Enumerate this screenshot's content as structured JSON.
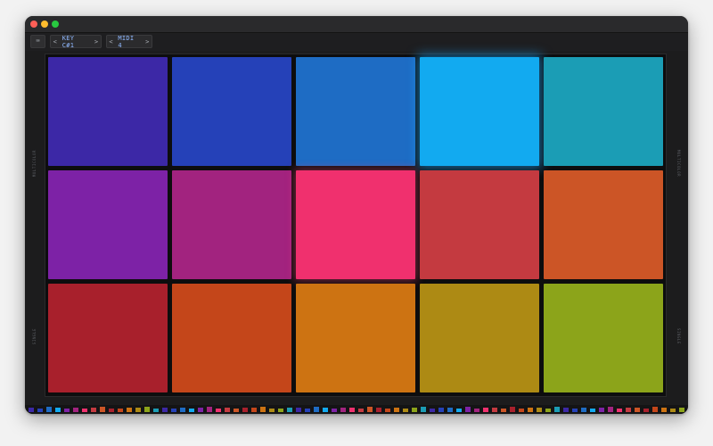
{
  "window": {
    "controls": [
      "close",
      "minimize",
      "zoom"
    ]
  },
  "toolbar": {
    "mode_icon": "keyboard-icon",
    "mode_glyph": "⌨",
    "key_selector": {
      "prev": "<",
      "value": "KEY C#1",
      "next": ">"
    },
    "midi_selector": {
      "prev": "<",
      "value": "MIDI 4",
      "next": ">"
    }
  },
  "side_labels": {
    "left_top": "MULTICOLOR",
    "left_bottom": "SINGLE",
    "right_top": "MULTICOLOR",
    "right_bottom": "SINGLE"
  },
  "pads": {
    "rows": [
      [
        {
          "color": "#3c28a6"
        },
        {
          "color": "#2541b8"
        },
        {
          "color": "#1e6cc4"
        },
        {
          "color": "#12aaf0",
          "active": true
        },
        {
          "color": "#1b9db5"
        }
      ],
      [
        {
          "color": "#7d22a6"
        },
        {
          "color": "#a2237f"
        },
        {
          "color": "#f0306e",
          "active": true
        },
        {
          "color": "#c43a40"
        },
        {
          "color": "#cc5526"
        }
      ],
      [
        {
          "color": "#a8202c"
        },
        {
          "color": "#c4461a"
        },
        {
          "color": "#cd7312"
        },
        {
          "color": "#ad8a14"
        },
        {
          "color": "#8ca41a"
        }
      ]
    ]
  },
  "level_meter": {
    "colors": [
      "#3c28a6",
      "#2541b8",
      "#1e6cc4",
      "#12aaf0",
      "#7d22a6",
      "#a2237f",
      "#f0306e",
      "#c43a40",
      "#cc5526",
      "#a8202c",
      "#c4461a",
      "#cd7312",
      "#ad8a14",
      "#8ca41a",
      "#1b9db5"
    ],
    "levels": [
      0.5,
      0.4,
      0.7,
      0.5,
      0.3,
      0.6,
      0.4,
      0.5,
      0.8,
      0.4,
      0.3,
      0.6,
      0.5,
      0.7,
      0.4,
      0.5,
      0.3,
      0.6,
      0.4,
      0.5,
      0.7,
      0.3,
      0.5,
      0.4,
      0.6,
      0.5,
      0.8,
      0.4,
      0.3,
      0.5,
      0.6,
      0.4,
      0.7,
      0.5,
      0.3,
      0.6,
      0.5,
      0.4,
      0.7,
      0.5,
      0.4,
      0.6,
      0.3,
      0.5,
      0.8,
      0.4,
      0.6,
      0.5,
      0.3,
      0.7,
      0.4,
      0.5,
      0.6,
      0.4,
      0.7,
      0.3,
      0.5,
      0.6,
      0.4,
      0.8,
      0.5,
      0.4,
      0.6,
      0.3,
      0.5,
      0.7,
      0.4,
      0.6,
      0.5,
      0.3,
      0.7,
      0.5,
      0.4,
      0.6
    ]
  }
}
